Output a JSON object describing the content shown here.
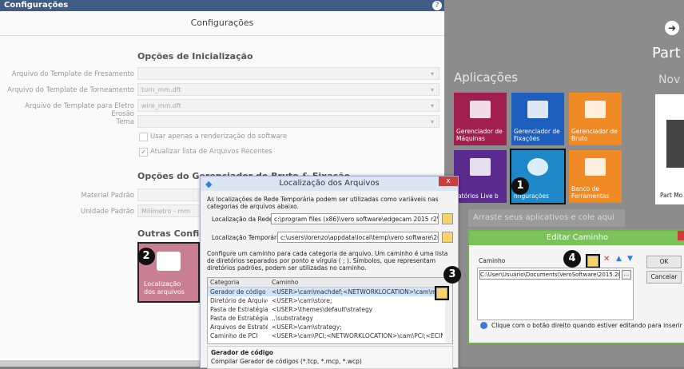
{
  "config_window": {
    "title": "Configurações",
    "header": "Configurações",
    "help_icon": "?",
    "section_init": "Opções de Inicialização",
    "fields": [
      {
        "label": "Arquivo do Template de Fresamento",
        "value": ""
      },
      {
        "label": "Arquivo do Template de Torneamento",
        "value": "turn_mm.dft"
      },
      {
        "label": "Arquivo de Template para Eletro Erosão",
        "value": "wire_mm.dft"
      },
      {
        "label": "Tema",
        "value": ""
      }
    ],
    "checkboxes": [
      {
        "label": "Usar apenas a renderização do software",
        "checked": false
      },
      {
        "label": "Atualizar lista de Arquivos Recentes",
        "checked": true
      }
    ],
    "section_stock": "Opções do Gerenciador de Bruto & Fixação",
    "material_label": "Material Padrão",
    "units_label": "Unidade Padrão",
    "units_value": "Milímetro - mm",
    "section_other": "Outras Configur",
    "loc_tile_label_1": "Localização",
    "loc_tile_label_2": "dos arquivos"
  },
  "background_app": {
    "applications_title": "Aplicações",
    "part_title": "Part",
    "novo_title": "Nov",
    "drop_text": "Arraste seus aplicativos e cole aqui",
    "tiles": [
      {
        "label": "Gerenciador de Máquinas",
        "color": "#a01f4f"
      },
      {
        "label": "Gerenciador de Fixações",
        "color": "#1e5fbd"
      },
      {
        "label": "Gerenciador de Bruto",
        "color": "#f08a24"
      },
      {
        "label": "latórios Live b",
        "color": "#5a2a8f"
      },
      {
        "label": "nfigurações",
        "color": "#1e88c8"
      },
      {
        "label": "Banco de Ferramentas",
        "color": "#f08a24"
      }
    ],
    "part_label": "Part Mo"
  },
  "loc_dialog": {
    "title": "Localização dos Arquivos",
    "close": "x",
    "intro": "As localizações de Rede Temporária podem ser utilizadas como variáveis nas categorias de arquivos abaixo.",
    "network_label": "Localização da Rede",
    "network_value": "c:\\program files (x86)\\vero software\\edgecam 2015 r2\\",
    "temp_label": "Localização Temporária",
    "temp_value": "c:\\users\\lorenzo\\appdata\\local\\temp\\vero software\\2015.20\\",
    "instructions": "Configure um caminho para cada categoria de arquivo. Um caminho é uma lista de diretórios separados por ponto e vírgula ( ; ). Símbolos, que representam diretórios padrões, podem ser utilizadas no caminho.",
    "col_category": "Categoria",
    "col_path": "Caminho",
    "rows": [
      {
        "category": "Gerador de código",
        "path": "<USER>\\cam\\machdef;<NETWORKLOCATION>\\cam\\machdef"
      },
      {
        "category": "Diretório de Arquivo...",
        "path": "<USER>\\cam\\store;"
      },
      {
        "category": "Pasta de Estratégias",
        "path": "<USER>\\themes\\default\\strategy"
      },
      {
        "category": "Pasta de Estratégias",
        "path": "..\\substrategy"
      },
      {
        "category": "Arquivos de Estraté...",
        "path": "<USER>\\cam\\strategy;"
      },
      {
        "category": "Caminho de PCI",
        "path": "<USER>\\cam\\PCI;<NETWORKLOCATION>\\cam\\PCI;<ECINS..."
      }
    ],
    "desc_title": "Gerador de código",
    "desc_text": "Compilar Gerador de códigos (*.tcp, *.mcp, *.wcp)"
  },
  "edit_dialog": {
    "title": "Editar Caminho",
    "path_label": "Caminho",
    "path_value": "C:\\User\\Usuário\\Documents\\VeroSoftware\\2015.20",
    "more": "...",
    "ok": "OK",
    "cancel": "Cancelar",
    "info": "Clique com o botão direito quando estiver editando para inserir uma variáv"
  },
  "badges": [
    "1",
    "2",
    "3",
    "4"
  ],
  "arrow_icon": "➜"
}
